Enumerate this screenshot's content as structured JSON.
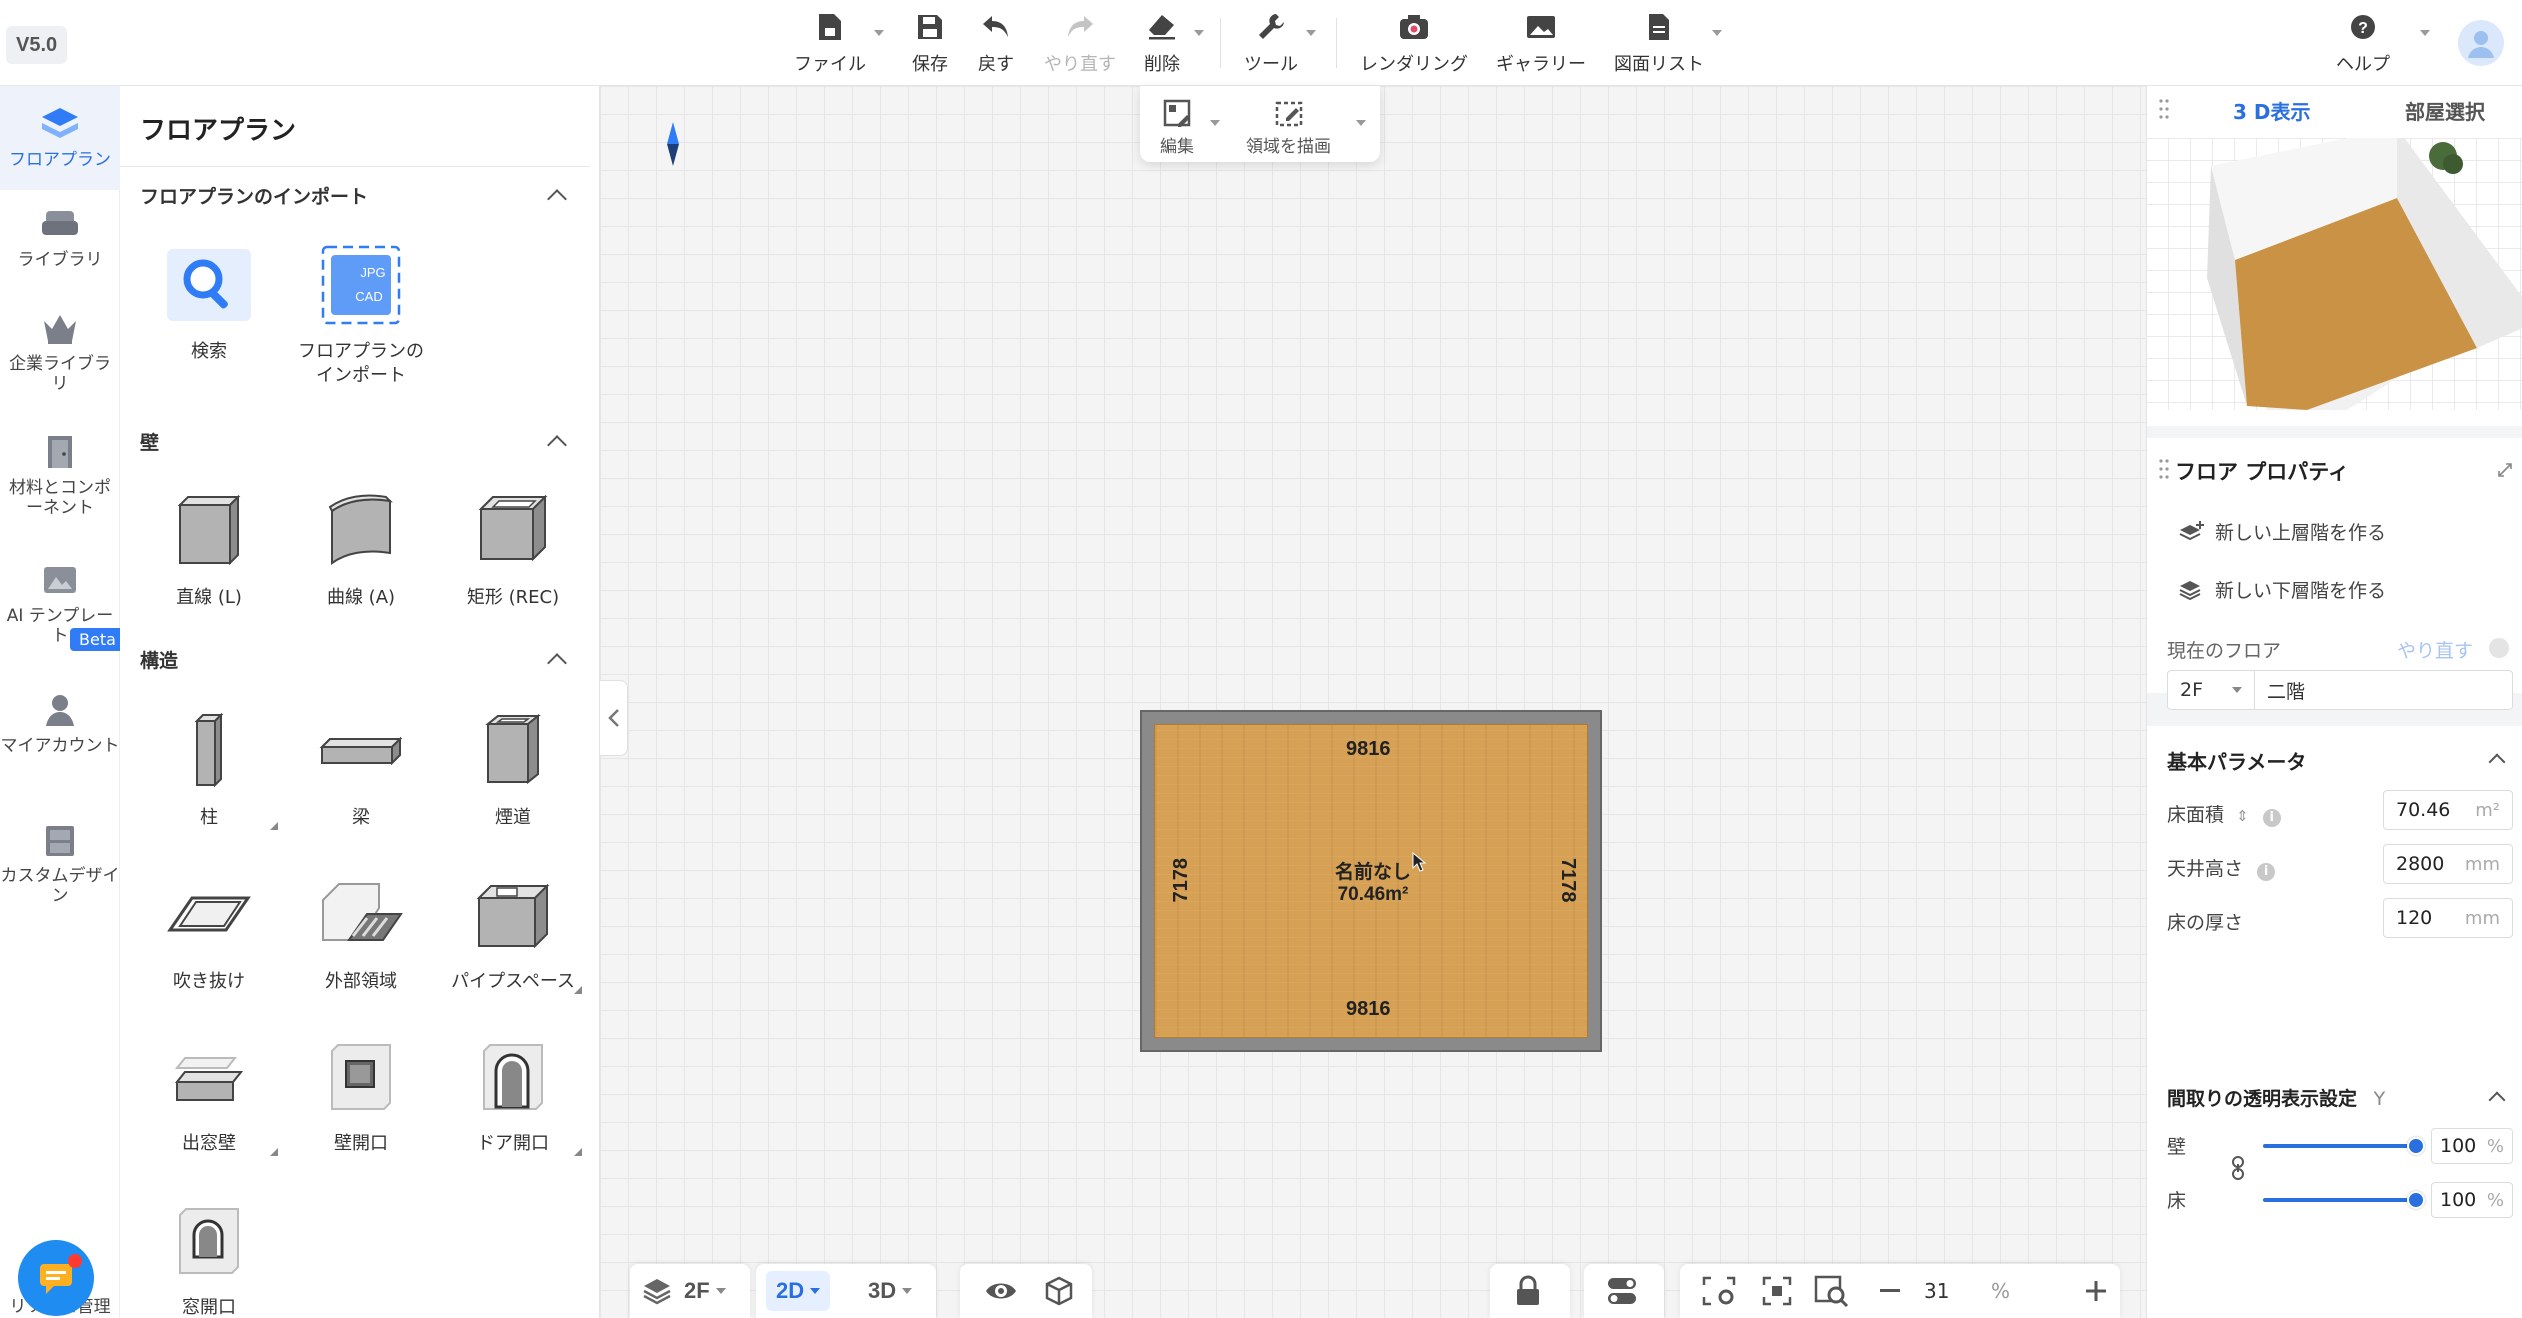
{
  "app": {
    "version": "V5.0"
  },
  "toolbar": {
    "file": "ファイル",
    "save": "保存",
    "undo": "戻す",
    "redo": "やり直す",
    "delete": "削除",
    "tools": "ツール",
    "rendering": "レンダリング",
    "gallery": "ギャラリー",
    "drawing_list": "図面リスト",
    "help": "ヘルプ"
  },
  "leftnav": {
    "items": [
      {
        "label": "フロアプラン",
        "icon": "floorplan-icon",
        "active": true
      },
      {
        "label": "ライブラリ",
        "icon": "sofa-icon"
      },
      {
        "label": "企業ライブラリ",
        "icon": "crown-icon"
      },
      {
        "label": "材料とコンポーネント",
        "icon": "door-icon"
      },
      {
        "label": "AI テンプレート",
        "icon": "ai-template-icon"
      },
      {
        "label": "マイアカウント",
        "icon": "user-icon"
      },
      {
        "label": "カスタムデザイン",
        "icon": "cabinet-icon"
      }
    ],
    "beta_badge": "Beta",
    "bottom_text": "リソース管理"
  },
  "library": {
    "title": "フロアプラン",
    "import_section": {
      "heading": "フロアプランのインポート",
      "items": [
        "検索",
        "フロアプランのインポート"
      ],
      "badge_jpg": "JPG",
      "badge_cad": "CAD"
    },
    "wall_section": {
      "heading": "壁",
      "items": [
        "直線 (L)",
        "曲線 (A)",
        "矩形 (REC)"
      ]
    },
    "structure_section": {
      "heading": "構造",
      "items": [
        "柱",
        "梁",
        "煙道",
        "吹き抜け",
        "外部領域",
        "パイプスペース",
        "出窓壁",
        "壁開口",
        "ドア開口",
        "窓開口"
      ]
    }
  },
  "canvas_toolbar": {
    "edit": "編集",
    "draw_area": "領域を描画"
  },
  "room": {
    "name": "名前なし",
    "area": "70.46m²",
    "dim_top": "9816",
    "dim_bottom": "9816",
    "dim_left": "7178",
    "dim_right": "7178"
  },
  "bottombar": {
    "floor": "2F",
    "mode_2d": "2D",
    "mode_3d": "3D",
    "zoom": "31",
    "zoom_unit": "%"
  },
  "right": {
    "tab_3d": "3 D表示",
    "tab_room": "部屋選択",
    "props_title": "フロア プロパティ",
    "new_upper": "新しい上層階を作る",
    "new_lower": "新しい下層階を作る",
    "current_floor_label": "現在のフロア",
    "redo_label": "やり直す",
    "floor_code": "2F",
    "floor_name": "二階",
    "basic_params": "基本パラメータ",
    "floor_area_label": "床面積",
    "floor_area": "70.46",
    "floor_area_unit": "m²",
    "ceiling_label": "天井高さ",
    "ceiling": "2800",
    "ceiling_unit": "mm",
    "thickness_label": "床の厚さ",
    "thickness": "120",
    "thickness_unit": "mm",
    "transparency_title": "間取りの透明表示設定",
    "transparency_key": "Y",
    "wall_label": "壁",
    "wall_value": "100",
    "floor_label": "床",
    "floor_value": "100",
    "percent": "%"
  },
  "colors": {
    "accent": "#2a6fe0",
    "floor_wood": "#d6a055",
    "beta": "#2f7cf6"
  }
}
